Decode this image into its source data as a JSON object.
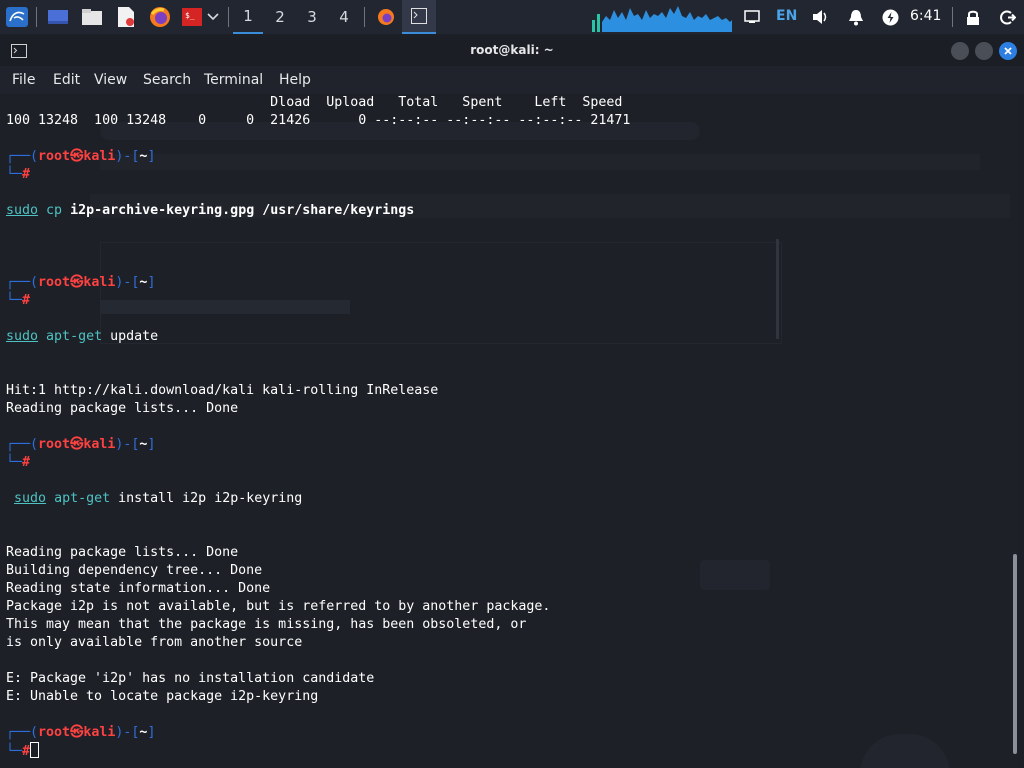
{
  "panel": {
    "workspaces": [
      "1",
      "2",
      "3",
      "4"
    ],
    "active_workspace": "1",
    "language": "EN",
    "clock": "6:41",
    "accent_color": "#3b8cd9",
    "icons": [
      "kali-menu-icon",
      "show-desktop-icon",
      "file-manager-icon",
      "text-editor-icon",
      "firefox-icon",
      "terminal-red-icon",
      "chevron-down-icon",
      "firefox-task-icon",
      "terminal-task-icon",
      "cpu-graph",
      "display-icon",
      "volume-icon",
      "bell-icon",
      "power-icon",
      "lock-icon",
      "logout-icon"
    ]
  },
  "window": {
    "title": "root@kali: ~"
  },
  "menu": {
    "file": "File",
    "edit": "Edit",
    "view": "View",
    "search": "Search",
    "terminal": "Terminal",
    "help": "Help"
  },
  "terminal": {
    "curl_header": "                                 Dload  Upload   Total   Spent    Left  Speed",
    "curl_progress": "100 13248  100 13248    0     0  21426      0 --:--:-- --:--:-- --:--:-- 21471",
    "prompt": {
      "corner_top": "┌──(",
      "user": "root",
      "at": "㉿",
      "host": "kali",
      "mid": ")-[",
      "dir": "~",
      "close": "]",
      "corner_bottom": "└─",
      "hash": "#"
    },
    "cmd1": {
      "sudo": "sudo",
      "bin": "cp",
      "args": "i2p-archive-keyring.gpg /usr/share/keyrings"
    },
    "cmd2": {
      "sudo": "sudo",
      "bin": "apt-get",
      "args": "update"
    },
    "update_out": [
      "Hit:1 http://kali.download/kali kali-rolling InRelease",
      "Reading package lists... Done"
    ],
    "cmd3": {
      "sudo": "sudo",
      "bin": "apt-get",
      "args": "install i2p i2p-keyring"
    },
    "install_out": [
      "Reading package lists... Done",
      "Building dependency tree... Done",
      "Reading state information... Done",
      "Package i2p is not available, but is referred to by another package.",
      "This may mean that the package is missing, has been obsoleted, or",
      "is only available from another source",
      "",
      "E: Package 'i2p' has no installation candidate",
      "E: Unable to locate package i2p-keyring"
    ]
  }
}
